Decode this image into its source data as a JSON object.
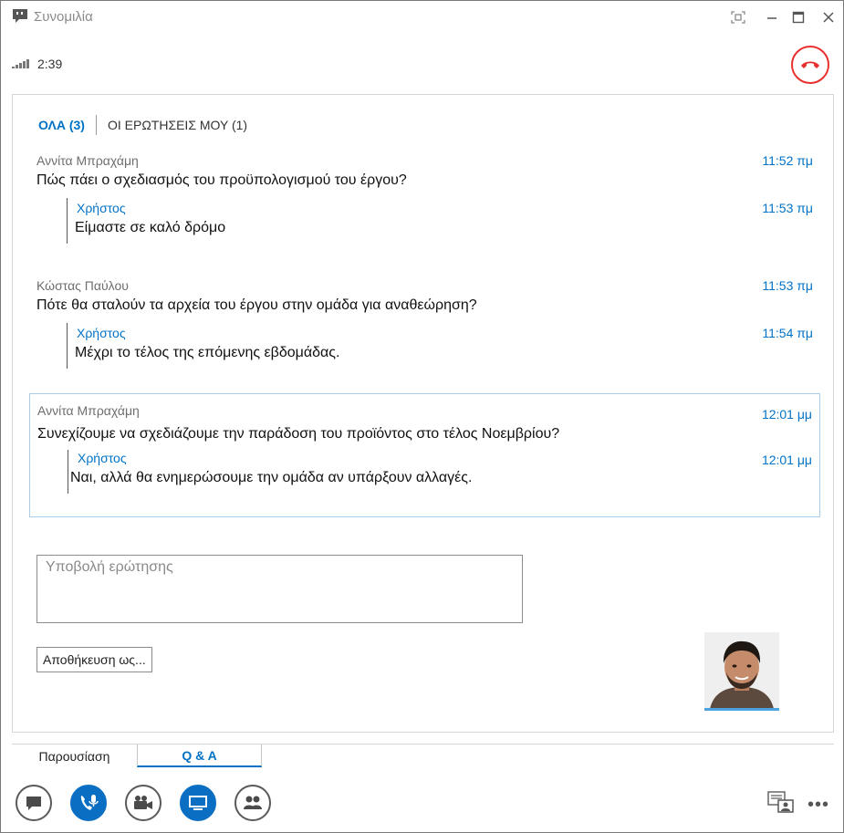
{
  "window": {
    "title": "Συνομιλία"
  },
  "call": {
    "duration": "2:39"
  },
  "qa_tabs": {
    "all_label": "ΟΛΑ (3)",
    "mine_label": "ΟΙ ΕΡΩΤΗΣΕΙΣ ΜΟΥ (1)"
  },
  "threads": [
    {
      "author": "Αννίτα Μπραχάμη",
      "time": "11:52 πμ",
      "question": "Πώς πάει ο σχεδιασμός του προϋπολογισμού του έργου?",
      "reply_author": "Χρήστος",
      "reply_time": "11:53 πμ",
      "reply": "Είμαστε σε καλό δρόμο"
    },
    {
      "author": "Κώστας Παύλου",
      "time": "11:53 πμ",
      "question": "Πότε θα σταλούν τα αρχεία του έργου στην ομάδα για αναθεώρηση?",
      "reply_author": "Χρήστος",
      "reply_time": "11:54 πμ",
      "reply": "Μέχρι το τέλος της επόμενης εβδομάδας."
    },
    {
      "author": "Αννίτα Μπραχάμη",
      "time": "12:01 μμ",
      "question": "Συνεχίζουμε να σχεδιάζουμε την παράδοση του προϊόντος στο τέλος Νοεμβρίου?",
      "reply_author": "Χρήστος",
      "reply_time": "12:01 μμ",
      "reply": "Ναι, αλλά θα ενημερώσουμε την ομάδα αν υπάρξουν αλλαγές."
    }
  ],
  "question_input": {
    "placeholder": "Υποβολή ερώτησης",
    "value": ""
  },
  "save_as_label": "Αποθήκευση ως...",
  "bottom_tabs": {
    "presentation": "Παρουσίαση",
    "qa": "Q & A"
  },
  "toolbar": {
    "more": "•••"
  },
  "colors": {
    "accent": "#0072c6",
    "hangup": "#e8312f",
    "selected_border": "#a9cde8"
  }
}
